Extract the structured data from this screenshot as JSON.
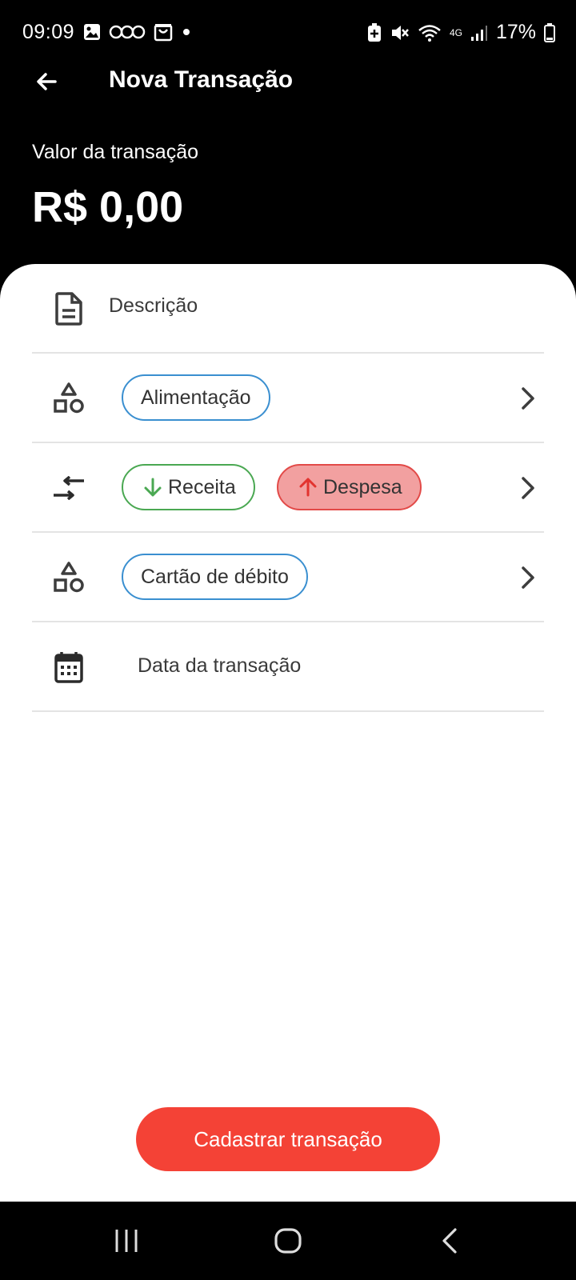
{
  "status_bar": {
    "time": "09:09",
    "battery": "17%",
    "network_label": "4G"
  },
  "header": {
    "title": "Nova Transação"
  },
  "amount": {
    "label": "Valor da transação",
    "value": "R$ 0,00"
  },
  "form": {
    "description_placeholder": "Descrição",
    "category_chip": "Alimentação",
    "income_chip": "Receita",
    "expense_chip": "Despesa",
    "account_chip": "Cartão de débito",
    "date_placeholder": "Data da transação"
  },
  "submit_label": "Cadastrar transação",
  "colors": {
    "primary": "#f44236",
    "income": "#4aa852",
    "expense": "#e24a48",
    "chip_blue": "#3a8fd0"
  }
}
